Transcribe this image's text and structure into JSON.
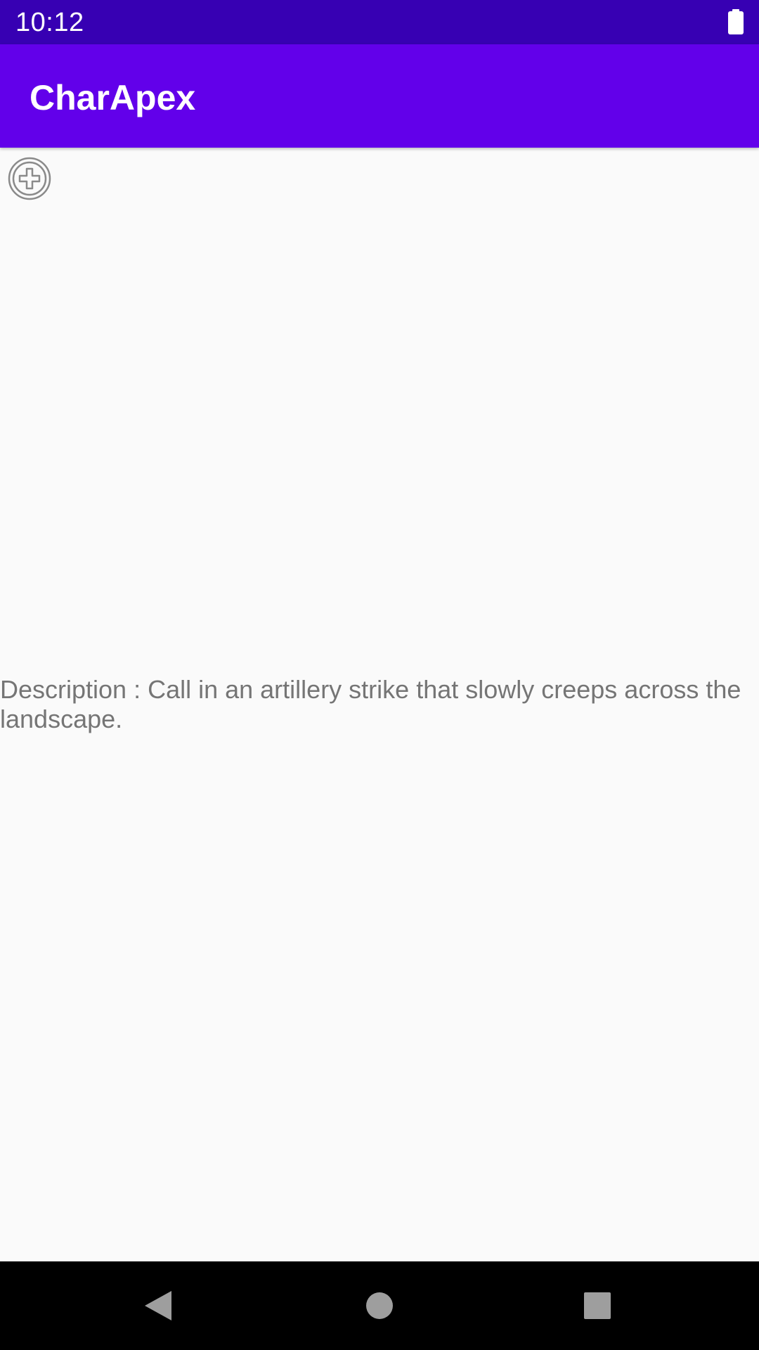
{
  "status_bar": {
    "time": "10:12",
    "battery_icon": "battery-full-icon"
  },
  "app_bar": {
    "title": "CharApex",
    "color": "#6200ea"
  },
  "toolbar": {
    "add_icon": "add-circle-icon"
  },
  "content": {
    "description": "Description : Call in an artillery strike that slowly creeps across the landscape."
  },
  "nav_bar": {
    "back_icon": "back-triangle-icon",
    "home_icon": "home-circle-icon",
    "recents_icon": "recents-square-icon"
  },
  "colors": {
    "status_bar": "#3700b3",
    "app_bar": "#6200ea",
    "background": "#fafafa",
    "description_text": "#757575",
    "nav_bar": "#000000"
  }
}
